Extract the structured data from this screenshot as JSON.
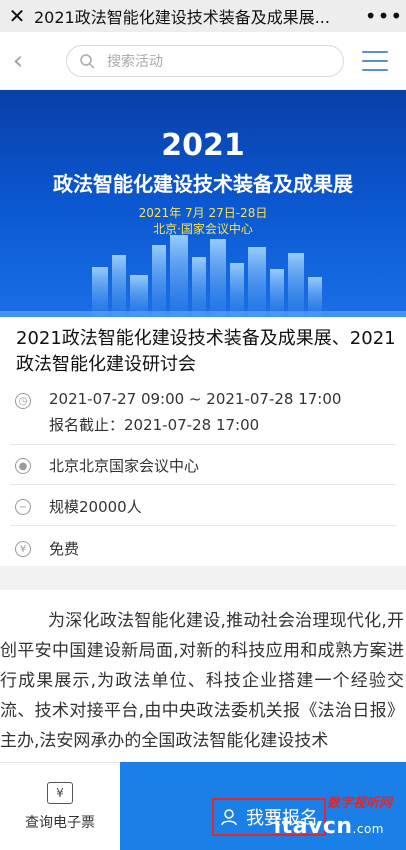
{
  "topbar": {
    "title": "2021政法智能化建设技术装备及成果展...",
    "more": "•••"
  },
  "search": {
    "placeholder": "搜索活动"
  },
  "banner": {
    "year": "2021",
    "title": "政法智能化建设技术装备及成果展",
    "date": "2021年 7月 27日-28日",
    "place": "北京·国家会议中心"
  },
  "event": {
    "title": "2021政法智能化建设技术装备及成果展、2021政法智能化建设研讨会",
    "time": "2021-07-27 09:00 ~ 2021-07-28 17:00",
    "deadline": "报名截止：2021-07-28 17:00",
    "location": "北京北京国家会议中心",
    "scale": "规模20000人",
    "fee": "免费"
  },
  "article": {
    "text": "为深化政法智能化建设,推动社会治理现代化,开创平安中国建设新局面,对新的科技应用和成熟方案进行成果展示,为政法单位、科技企业搭建一个经验交流、技术对接平台,由中央政法委机关报《法治日报》主办,法安网承办的全国政法智能化建设技术"
  },
  "bottom": {
    "ticket_label": "查询电子票",
    "signup_label": "我要报名"
  },
  "watermark": {
    "line1": "数字视听网",
    "line2": "itavcn",
    "suffix": ".com"
  },
  "colors": {
    "primary": "#1a7fe6",
    "banner": "#0b5ad4",
    "highlight": "#e3262b"
  }
}
